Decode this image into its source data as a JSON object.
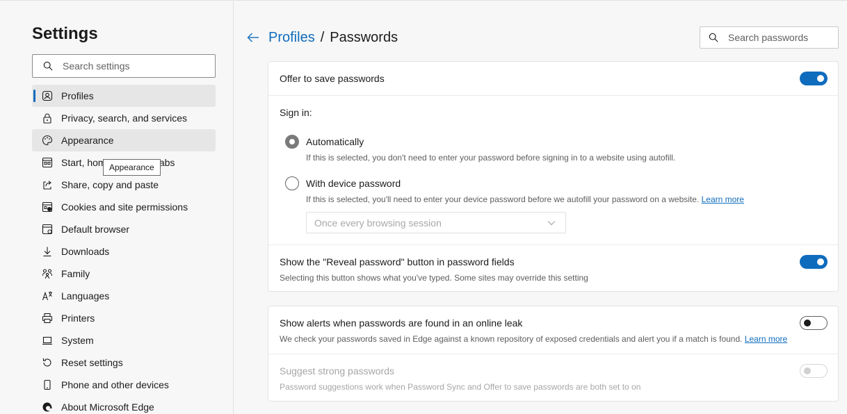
{
  "sidebar": {
    "title": "Settings",
    "search_placeholder": "Search settings",
    "items": [
      {
        "label": "Profiles",
        "icon": "profile-icon"
      },
      {
        "label": "Privacy, search, and services",
        "icon": "lock-icon"
      },
      {
        "label": "Appearance",
        "icon": "palette-icon"
      },
      {
        "label": "Start, home, and new tabs",
        "icon": "home-tabs-icon"
      },
      {
        "label": "Share, copy and paste",
        "icon": "share-icon"
      },
      {
        "label": "Cookies and site permissions",
        "icon": "cookie-icon"
      },
      {
        "label": "Default browser",
        "icon": "browser-icon"
      },
      {
        "label": "Downloads",
        "icon": "download-icon"
      },
      {
        "label": "Family",
        "icon": "family-icon"
      },
      {
        "label": "Languages",
        "icon": "language-icon"
      },
      {
        "label": "Printers",
        "icon": "printer-icon"
      },
      {
        "label": "System",
        "icon": "laptop-icon"
      },
      {
        "label": "Reset settings",
        "icon": "reset-icon"
      },
      {
        "label": "Phone and other devices",
        "icon": "phone-icon"
      },
      {
        "label": "About Microsoft Edge",
        "icon": "edge-logo-icon"
      }
    ],
    "tooltip": "Appearance"
  },
  "header": {
    "breadcrumb_parent": "Profiles",
    "breadcrumb_separator": "/",
    "breadcrumb_current": "Passwords",
    "search_placeholder": "Search passwords"
  },
  "card1": {
    "offer_save": {
      "title": "Offer to save passwords",
      "enabled": true
    },
    "sign_in": {
      "label": "Sign in:",
      "options": [
        {
          "label": "Automatically",
          "desc": "If this is selected, you don't need to enter your password before signing in to a website using autofill.",
          "checked": true
        },
        {
          "label": "With device password",
          "desc": "If this is selected, you'll need to enter your device password before we autofill your password on a website.",
          "link": "Learn more",
          "checked": false
        }
      ],
      "frequency": "Once every browsing session"
    },
    "reveal": {
      "title": "Show the \"Reveal password\" button in password fields",
      "desc": "Selecting this button shows what you've typed. Some sites may override this setting",
      "enabled": true
    }
  },
  "card2": {
    "alerts": {
      "title": "Show alerts when passwords are found in an online leak",
      "desc": "We check your passwords saved in Edge against a known repository of exposed credentials and alert you if a match is found.",
      "link": "Learn more",
      "enabled": false
    },
    "suggest": {
      "title": "Suggest strong passwords",
      "desc": "Password suggestions work when Password Sync and Offer to save passwords are both set to on",
      "enabled": false,
      "disabled": true
    }
  },
  "colors": {
    "accent": "#0f6cbd",
    "background": "#f7f7f7",
    "card": "#ffffff"
  }
}
